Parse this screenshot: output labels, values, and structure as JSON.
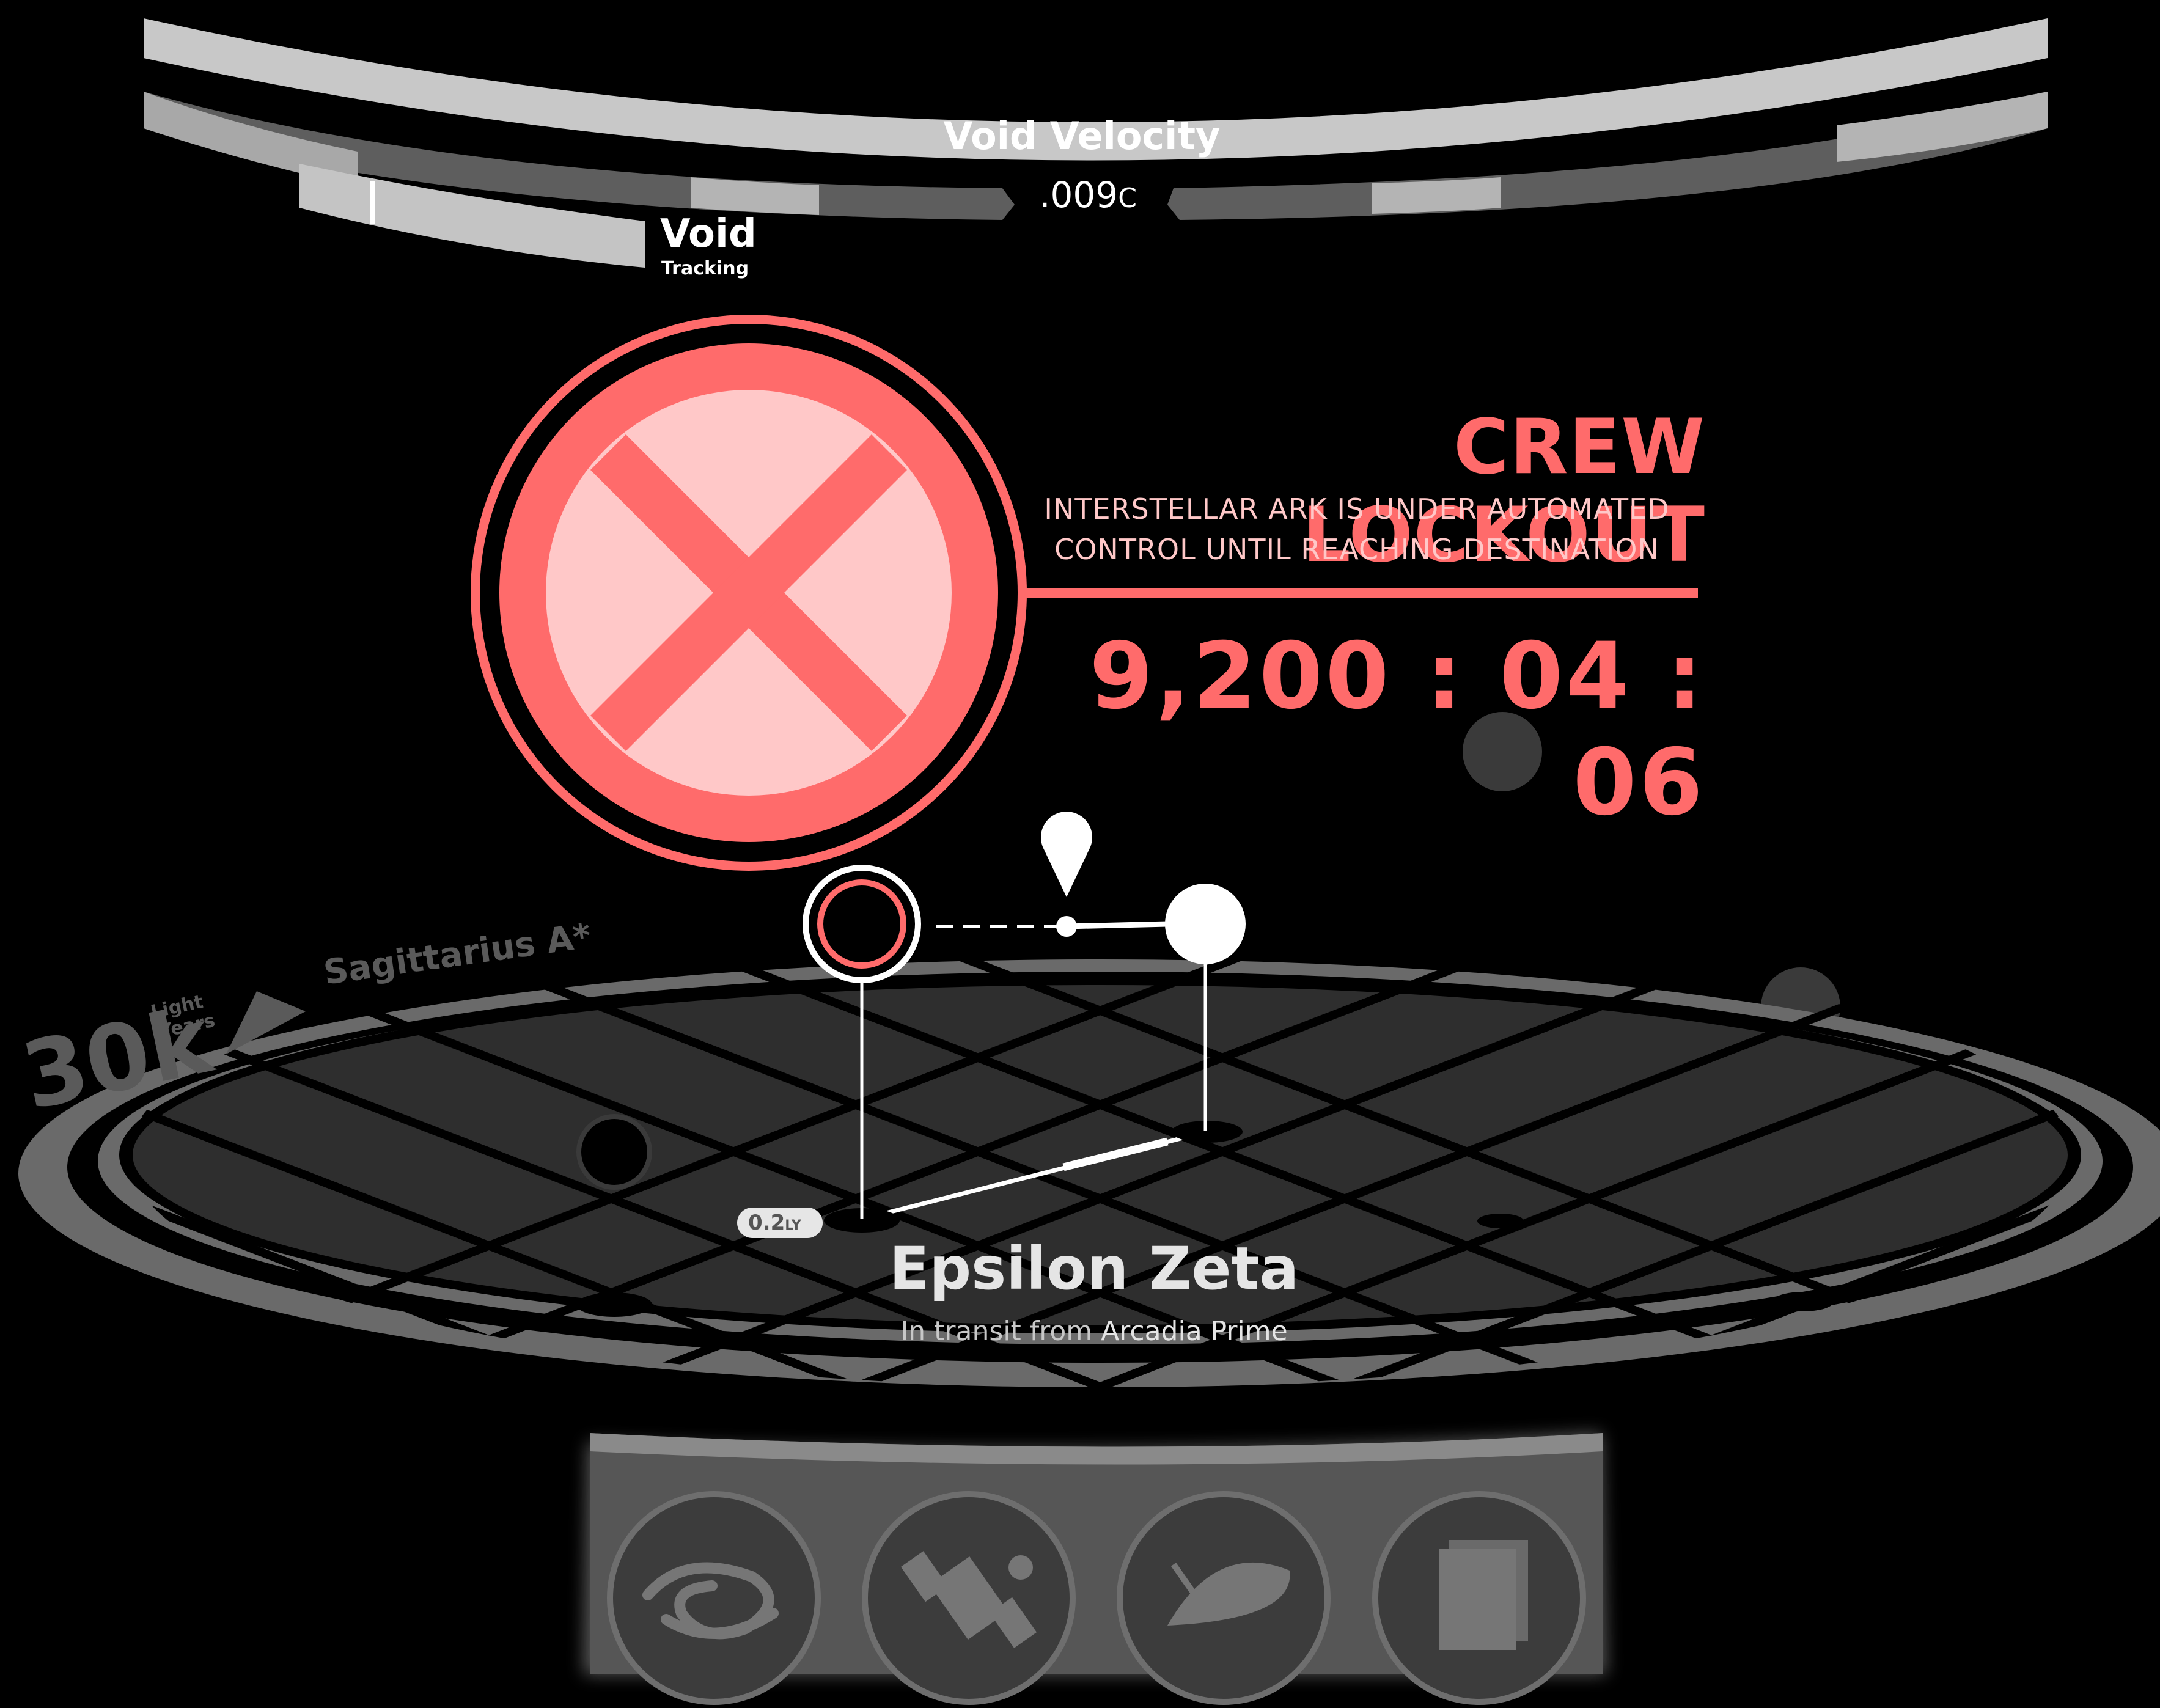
{
  "void_velocity": {
    "title": "Void Velocity",
    "value": ".009",
    "unit": "C"
  },
  "void_tracking": {
    "title": "Void",
    "subtitle": "Tracking"
  },
  "lockout": {
    "title": "CREW LOCKOUT",
    "message_line1": "INTERSTELLAR ARK IS UNDER AUTOMATED",
    "message_line2": "CONTROL UNTIL REACHING DESTINATION",
    "countdown": "9,200 : 04 : 06",
    "icon": "x-circle-icon",
    "color": "#ff6b6b",
    "light_color": "#ffc8c8"
  },
  "galaxy_map": {
    "reference_label": "Sagittarius A*",
    "distance_value": "30k",
    "distance_unit_line1": "Light",
    "distance_unit_line2": "Years",
    "segment_distance_value": "0.2",
    "segment_distance_unit": "LY"
  },
  "destination": {
    "name": "Epsilon Zeta",
    "transit_prefix": "In transit from",
    "origin": "Arcadia Prime"
  },
  "dock": {
    "buttons": [
      {
        "name": "galaxy-button",
        "icon": "spiral-galaxy-icon"
      },
      {
        "name": "satellite-button",
        "icon": "satellite-icon"
      },
      {
        "name": "radar-dish-button",
        "icon": "radar-dish-icon"
      },
      {
        "name": "documents-button",
        "icon": "documents-icon"
      }
    ]
  }
}
